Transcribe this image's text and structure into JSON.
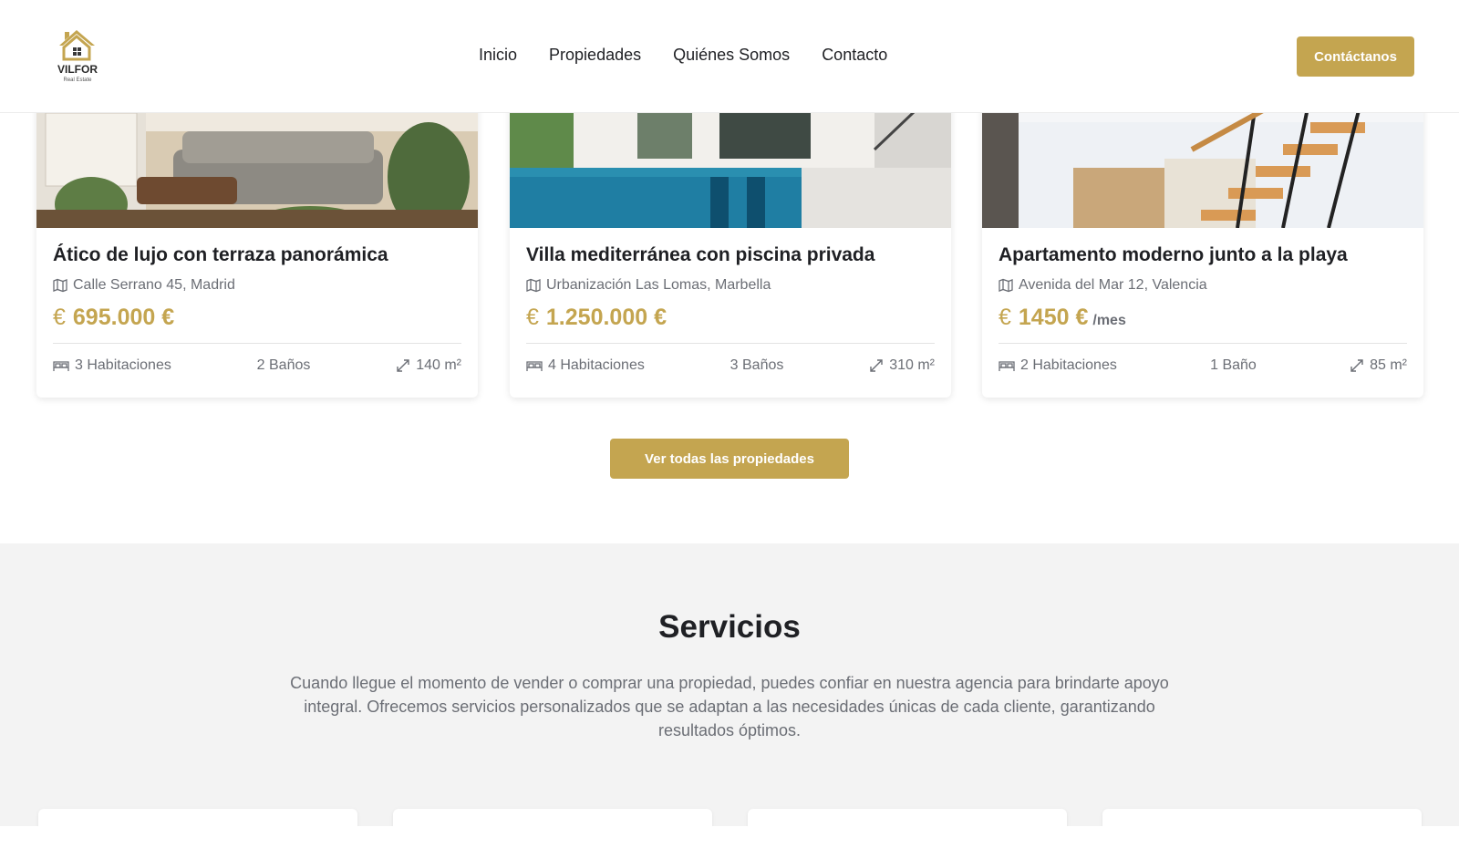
{
  "header": {
    "logo_name": "VILFOR",
    "logo_sub": "Real Estate",
    "nav": [
      "Inicio",
      "Propiedades",
      "Quiénes Somos",
      "Contacto"
    ],
    "cta": "Contáctanos"
  },
  "colors": {
    "accent": "#c4a550",
    "text": "#1f2024",
    "muted": "#6b6e75",
    "section_bg": "#f3f3f3"
  },
  "properties": [
    {
      "title": "Ático de lujo con terraza panorámica",
      "address": "Calle Serrano 45, Madrid",
      "currency_symbol": "€",
      "price": "695.000 €",
      "per": "",
      "rooms": "3 Habitaciones",
      "baths": "2 Baños",
      "area": "140 m²"
    },
    {
      "title": "Villa mediterránea con piscina privada",
      "address": "Urbanización Las Lomas, Marbella",
      "currency_symbol": "€",
      "price": "1.250.000 €",
      "per": "",
      "rooms": "4 Habitaciones",
      "baths": "3 Baños",
      "area": "310 m²"
    },
    {
      "title": "Apartamento moderno junto a la playa",
      "address": "Avenida del Mar 12, Valencia",
      "currency_symbol": "€",
      "price": "1450 €",
      "per": "/mes",
      "rooms": "2 Habitaciones",
      "baths": "1 Baño",
      "area": "85 m²"
    }
  ],
  "all_properties_button": "Ver todas las propiedades",
  "services": {
    "title": "Servicios",
    "description": "Cuando llegue el momento de vender o comprar una propiedad, puedes confiar en nuestra agencia para brindarte apoyo integral. Ofrecemos servicios personalizados que se adaptan a las necesidades únicas de cada cliente, garantizando resultados óptimos."
  }
}
